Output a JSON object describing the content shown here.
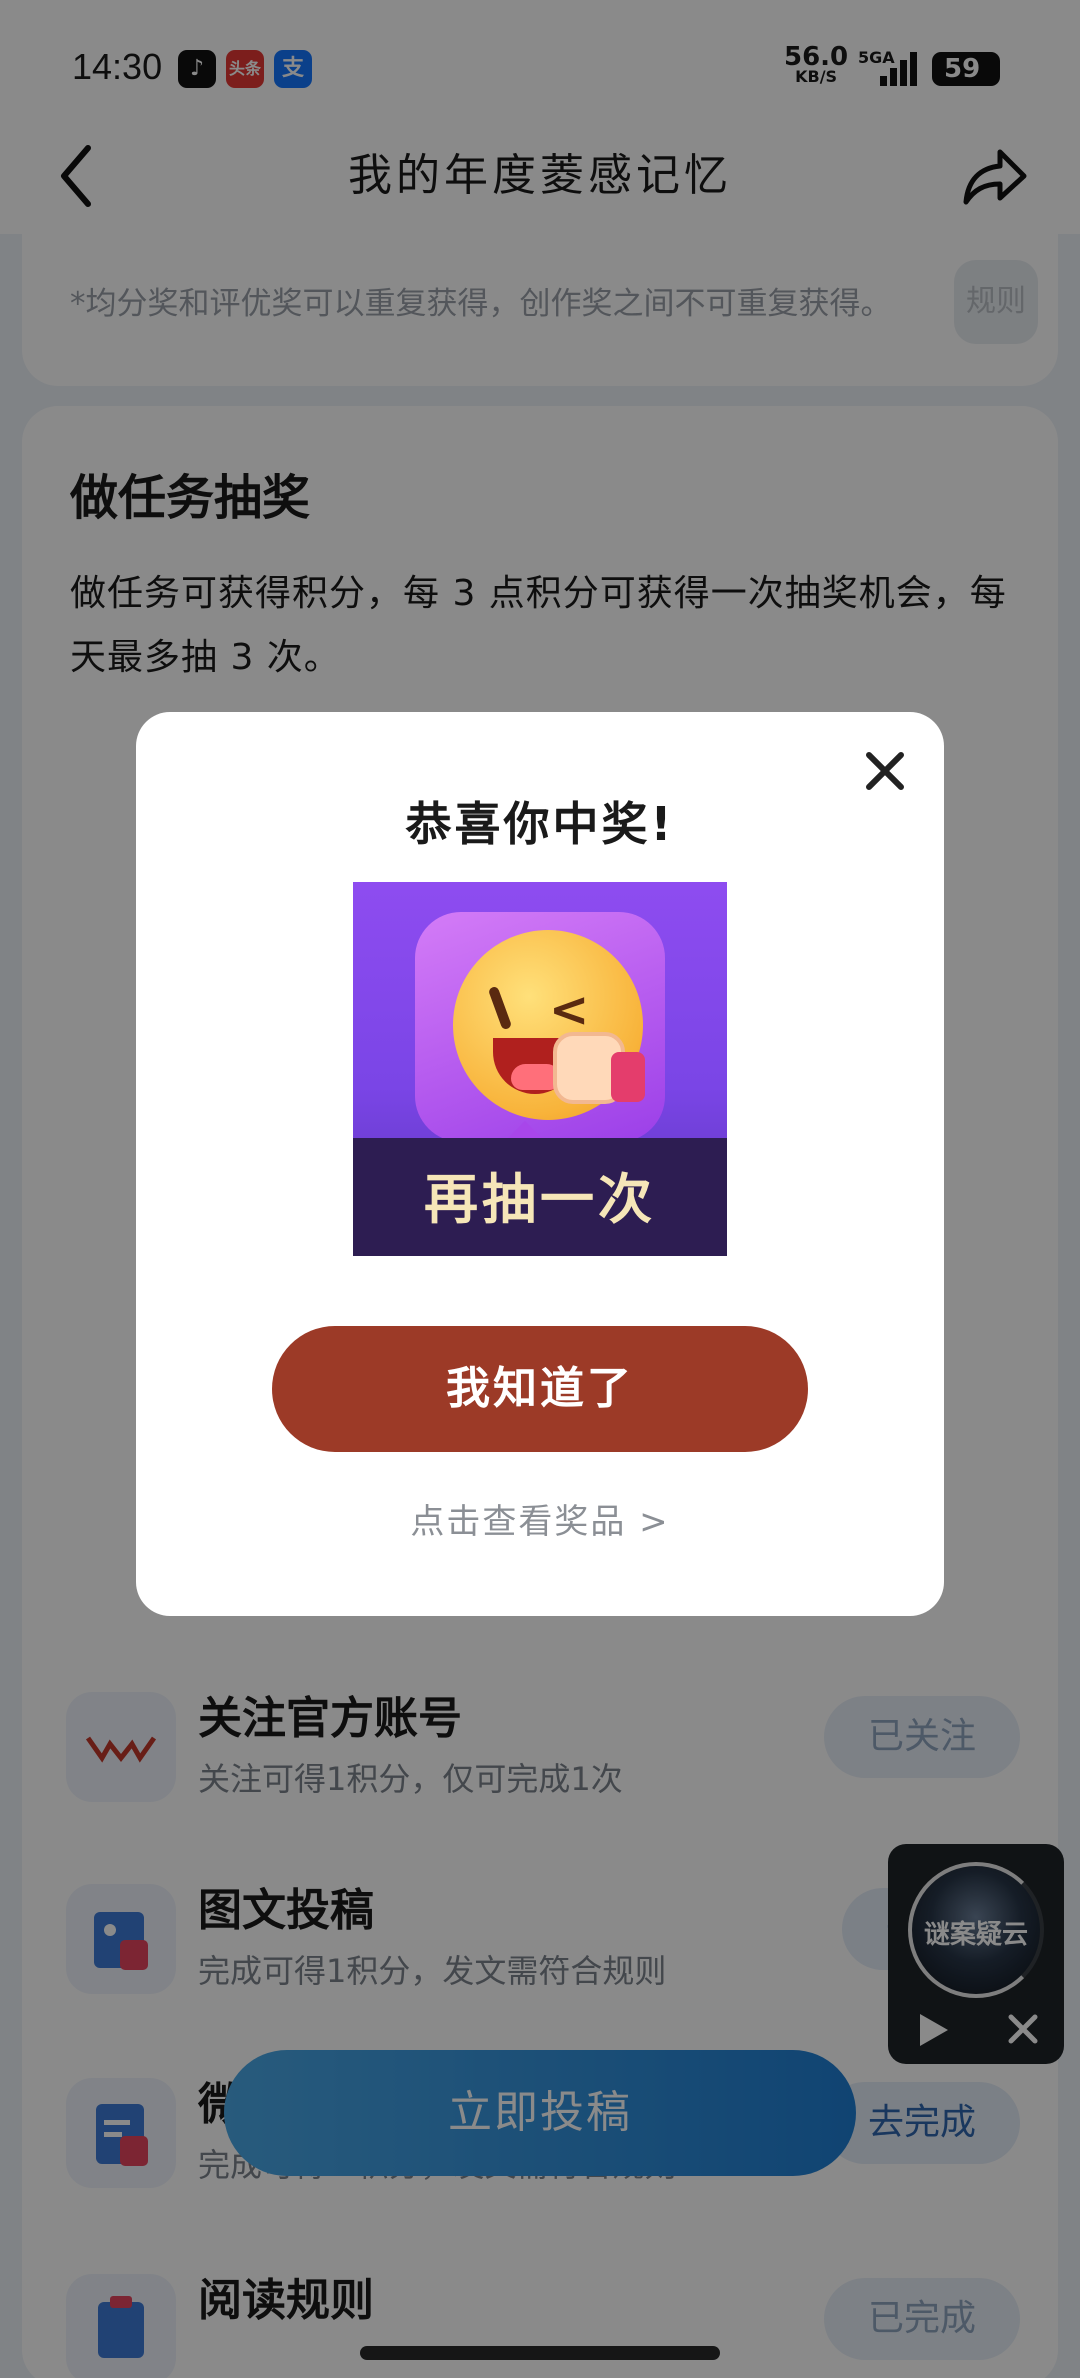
{
  "status_bar": {
    "time": "14:30",
    "net_speed": "56.0",
    "net_unit": "KB/S",
    "signal_label": "5GA",
    "battery": "59",
    "notification_apps": [
      {
        "name": "tiktok-icon",
        "glyph": "♪",
        "color": "#111111"
      },
      {
        "name": "toutiao-icon",
        "glyph": "头条",
        "color": "#e53935"
      },
      {
        "name": "alipay-icon",
        "glyph": "支",
        "color": "#1677ff"
      }
    ]
  },
  "header": {
    "title": "我的年度菱感记忆"
  },
  "notice_card": {
    "text": "*均分奖和评优奖可以重复获得，创作奖之间不可重复获得。",
    "rules_label": "规则"
  },
  "task_card": {
    "title": "做任务抽奖",
    "description": "做任务可获得积分，每 3 点积分可获得一次抽奖机会，每天最多抽 3 次。",
    "tasks": [
      {
        "name": "关注官方账号",
        "sub": "关注可得1积分，仅可完成1次",
        "button": "已关注",
        "icon": "wuling-logo-icon"
      },
      {
        "name": "图文投稿",
        "sub": "完成可得1积分，发文需符合规则",
        "button": "去完成",
        "icon": "image-post-icon"
      },
      {
        "name": "微",
        "sub": "完成可得 1积分，发文需符合规则",
        "button": "去完成",
        "icon": "document-icon"
      },
      {
        "name": "阅读规则",
        "sub": "",
        "button": "已完成",
        "icon": "clipboard-icon"
      }
    ],
    "submit_label": "立即投稿"
  },
  "mini_player": {
    "disc_label": "谜案疑云"
  },
  "dialog": {
    "title": "恭喜你中奖!",
    "prize_label": "再抽一次",
    "ok_label": "我知道了",
    "view_prizes": "点击查看奖品 >"
  },
  "colors": {
    "ok_button": "#9c3a27",
    "submit_button": "#1f7ed3",
    "prize_bg": "#8e4cf0"
  }
}
